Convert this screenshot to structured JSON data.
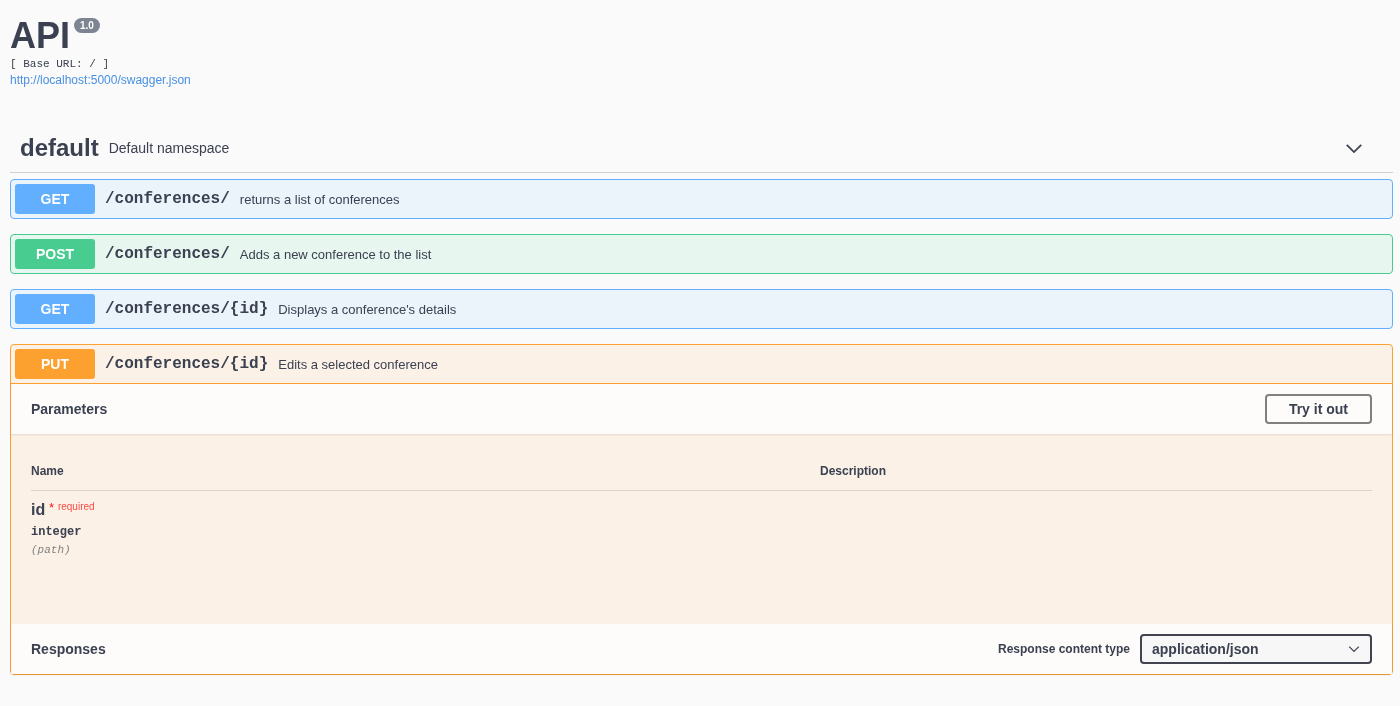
{
  "info": {
    "title": "API",
    "version": "1.0",
    "base_url": "[ Base URL: / ]",
    "spec_link": "http://localhost:5000/swagger.json"
  },
  "section": {
    "name": "default",
    "description": "Default namespace",
    "expanded": true
  },
  "operations": [
    {
      "method": "GET",
      "kind": "get",
      "path": "/conferences/",
      "summary": "returns a list of conferences",
      "expanded": false
    },
    {
      "method": "POST",
      "kind": "post",
      "path": "/conferences/",
      "summary": "Adds a new conference to the list",
      "expanded": false
    },
    {
      "method": "GET",
      "kind": "get",
      "path": "/conferences/{id}",
      "summary": "Displays a conference's details",
      "expanded": false
    },
    {
      "method": "PUT",
      "kind": "put",
      "path": "/conferences/{id}",
      "summary": "Edits a selected conference",
      "expanded": true,
      "parameters": {
        "title": "Parameters",
        "try_button": "Try it out",
        "columns": [
          "Name",
          "Description"
        ],
        "rows": [
          {
            "name": "id",
            "required_mark": "*",
            "required_label": "required",
            "type": "integer",
            "location": "(path)"
          }
        ]
      },
      "responses": {
        "title": "Responses",
        "content_type_label": "Response content type",
        "content_type": "application/json"
      }
    }
  ]
}
